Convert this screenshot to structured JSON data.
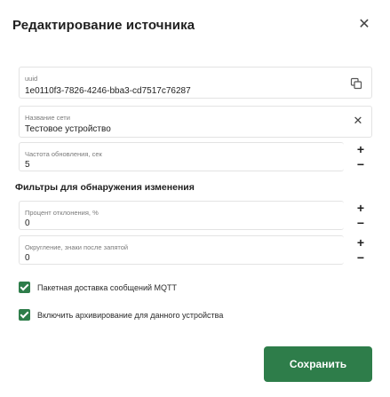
{
  "dialog": {
    "title": "Редактирование источника",
    "close_icon": "close-icon"
  },
  "fields": {
    "uuid": {
      "label": "uuid",
      "value": "1e0110f3-7826-4246-bba3-cd7517c76287",
      "icon": "copy-icon"
    },
    "name": {
      "label": "Название сети",
      "value": "Тестовое устройство",
      "icon": "clear-icon"
    },
    "frequency": {
      "label": "Частота обновления, сек",
      "value": "5"
    }
  },
  "filters": {
    "title": "Фильтры для обнаружения изменения",
    "deviation": {
      "label": "Процент отклонения, %",
      "value": "0"
    },
    "rounding": {
      "label": "Округление, знаки после запятой",
      "value": "0"
    }
  },
  "stepper": {
    "plus": "+",
    "minus": "−"
  },
  "checkboxes": [
    {
      "label": "Пакетная доставка сообщений MQTT",
      "checked": true
    },
    {
      "label": "Включить архивирование для данного устройства",
      "checked": true
    }
  ],
  "actions": {
    "save_label": "Сохранить"
  },
  "colors": {
    "accent": "#2e7d4a"
  }
}
